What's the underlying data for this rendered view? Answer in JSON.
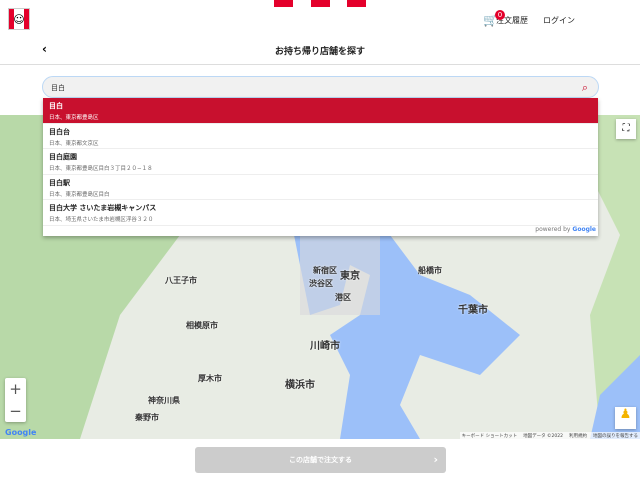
{
  "header": {
    "order_history": "注文履歴",
    "login": "ログイン",
    "cart_count": "0"
  },
  "page": {
    "title": "お持ち帰り店舗を探す",
    "back": "‹"
  },
  "search": {
    "value": "目白",
    "icon": "search-icon"
  },
  "suggestions": [
    {
      "main": "目白",
      "sub": "日本、東京都豊島区"
    },
    {
      "main": "目白台",
      "sub": "日本、東京都文京区"
    },
    {
      "main": "目白庭園",
      "sub": "日本、東京都豊島区目白３丁目２０−１８"
    },
    {
      "main": "目白駅",
      "sub": "日本、東京都豊島区目白"
    },
    {
      "main": "目白大学 さいたま岩槻キャンパス",
      "sub": "日本、埼玉県さいたま市岩槻区浮谷３２０"
    }
  ],
  "powered_by": "powered by",
  "google": "Google",
  "map": {
    "labels": {
      "tokyo": "東京",
      "shinjuku": "新宿区",
      "shibuya": "渋谷区",
      "minato": "港区",
      "kawasaki": "川崎市",
      "yokohama": "横浜市",
      "chiba": "千葉市",
      "hachioji": "八王子市",
      "sagamihara": "相模原市",
      "funabashi": "船橋市",
      "kanagawa": "神奈川県",
      "atsugi": "厚木市",
      "hadano": "秦野市"
    },
    "zoom_in": "+",
    "zoom_out": "−",
    "attribution": [
      "キーボード ショートカット",
      "地図データ ©2022",
      "利用規約",
      "地図の誤りを報告する"
    ],
    "colors": {
      "land": "#e8ece4",
      "water": "#9cc0f9",
      "forest": "#b8d9a8"
    }
  },
  "order_button": "この店舗で注文する",
  "colors": {
    "brand": "#c8102e"
  }
}
